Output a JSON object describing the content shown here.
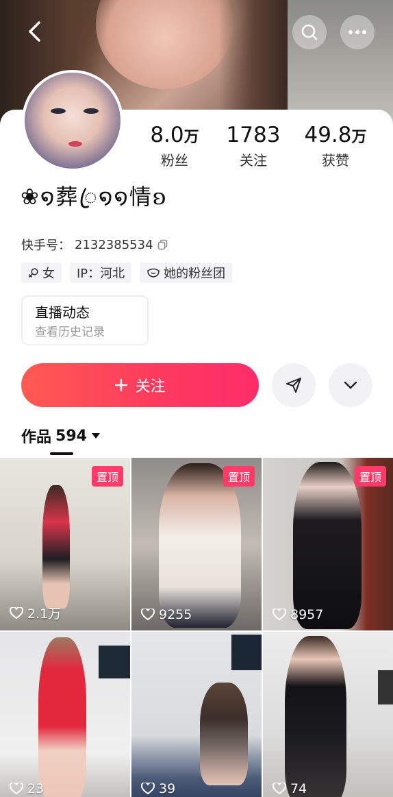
{
  "header": {
    "back_icon": "chevron-left-icon",
    "search_icon": "search-icon",
    "more_icon": "more-dots-icon"
  },
  "profile": {
    "nickname": "❀໑葬ꦿ໑໑情ʚ",
    "stats": [
      {
        "value": "8.0",
        "unit": "万",
        "label": "粉丝"
      },
      {
        "value": "1783",
        "unit": "",
        "label": "关注"
      },
      {
        "value": "49.8",
        "unit": "万",
        "label": "获赞"
      }
    ],
    "uid_label": "快手号：",
    "uid_value": "2132385534",
    "tags": [
      {
        "icon": "female-icon",
        "text": "女"
      },
      {
        "icon": "",
        "text": "IP：河北"
      },
      {
        "icon": "fan-club-icon",
        "text": "她的粉丝团"
      }
    ],
    "live_box": {
      "title": "直播动态",
      "subtitle": "查看历史记录"
    },
    "follow_label": "关注"
  },
  "tabs": {
    "works_label": "作品",
    "works_count": "594"
  },
  "videos": [
    {
      "pinned": "置顶",
      "likes": "2.1万"
    },
    {
      "pinned": "置顶",
      "likes": "9255"
    },
    {
      "pinned": "置顶",
      "likes": "8957"
    },
    {
      "pinned": "",
      "likes": "23"
    },
    {
      "pinned": "",
      "likes": "39"
    },
    {
      "pinned": "",
      "likes": "74"
    }
  ],
  "colors": {
    "accent": "#fe3b5e",
    "pin": "#fe3b68"
  }
}
